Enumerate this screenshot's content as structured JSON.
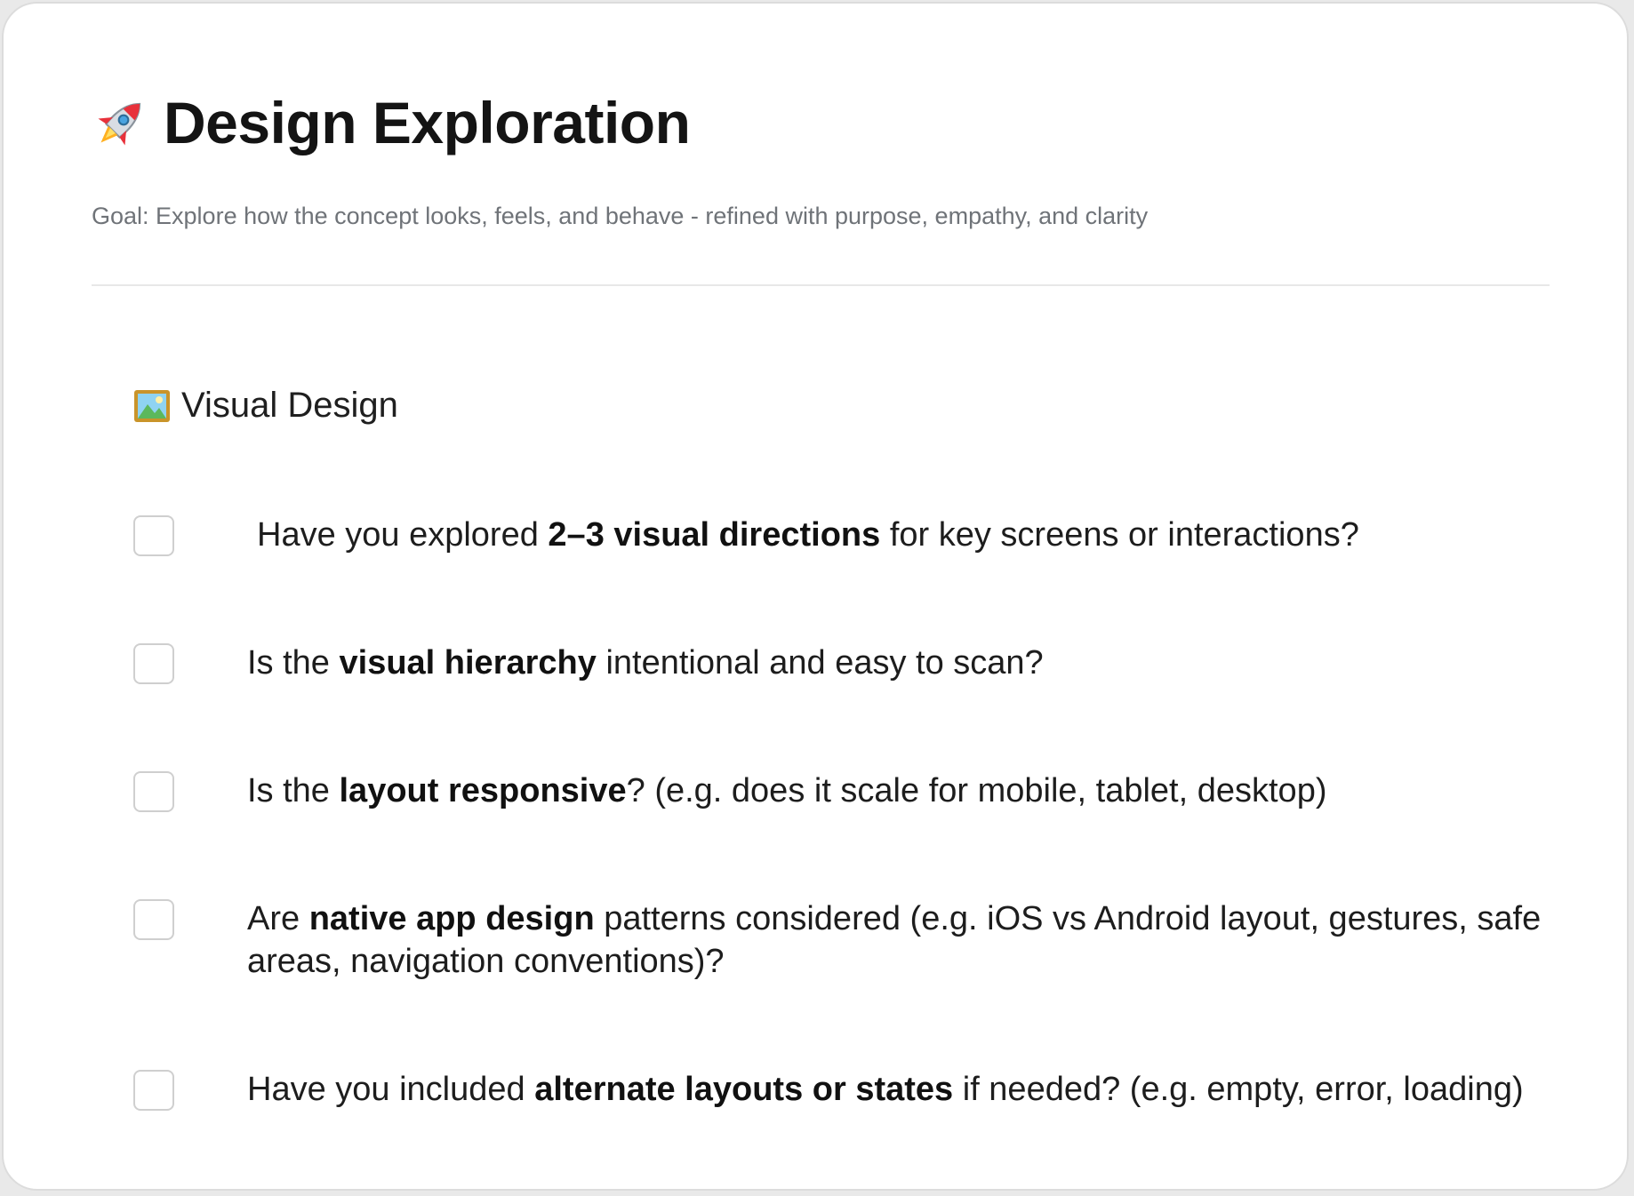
{
  "header": {
    "icon": "rocket-icon",
    "title": "Design Exploration",
    "goal": "Goal: Explore how the concept looks, feels, and behave - refined with purpose, empathy, and clarity"
  },
  "section": {
    "icon": "framed-picture-icon",
    "title": "Visual Design"
  },
  "checklist": [
    {
      "checked": false,
      "before": "Have you explored ",
      "bold": "2–3 visual directions",
      "after": " for key screens or interactions?"
    },
    {
      "checked": false,
      "before": "Is the ",
      "bold": "visual hierarchy",
      "after": " intentional and easy to scan?"
    },
    {
      "checked": false,
      "before": "Is the ",
      "bold": "layout responsive",
      "after": "? (e.g. does it scale for mobile, tablet, desktop)"
    },
    {
      "checked": false,
      "before": "Are ",
      "bold": "native app design",
      "after": " patterns considered (e.g. iOS vs Android layout, gestures, safe areas, navigation conventions)?"
    },
    {
      "checked": false,
      "before": "Have you included ",
      "bold": "alternate layouts or states",
      "after": " if needed? (e.g. empty, error, loading)"
    }
  ],
  "colors": {
    "title": "#141414",
    "goal": "#6f7378",
    "checkbox_border": "#cfcfcf",
    "divider": "#e8e8e8"
  }
}
